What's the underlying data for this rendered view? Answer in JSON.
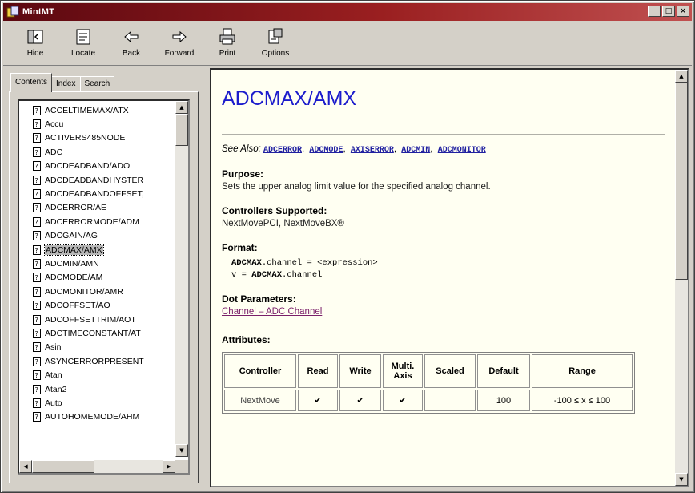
{
  "window": {
    "title": "MintMT"
  },
  "toolbar": {
    "buttons": [
      {
        "label": "Hide",
        "icon": "hide-icon"
      },
      {
        "label": "Locate",
        "icon": "locate-icon"
      },
      {
        "label": "Back",
        "icon": "back-arrow-icon"
      },
      {
        "label": "Forward",
        "icon": "forward-arrow-icon"
      },
      {
        "label": "Print",
        "icon": "print-icon"
      },
      {
        "label": "Options",
        "icon": "options-icon"
      }
    ]
  },
  "tabs": [
    {
      "label": "Contents",
      "active": true
    },
    {
      "label": "Index",
      "active": false
    },
    {
      "label": "Search",
      "active": false
    }
  ],
  "topic_list": {
    "selected": "ADCMAX/AMX",
    "items": [
      "ACCELTIMEMAX/ATX",
      "Accu",
      "ACTIVERS485NODE",
      "ADC",
      "ADCDEADBAND/ADO",
      "ADCDEADBANDHYSTER",
      "ADCDEADBANDOFFSET,",
      "ADCERROR/AE",
      "ADCERRORMODE/ADM",
      "ADCGAIN/AG",
      "ADCMAX/AMX",
      "ADCMIN/AMN",
      "ADCMODE/AM",
      "ADCMONITOR/AMR",
      "ADCOFFSET/AO",
      "ADCOFFSETTRIM/AOT",
      "ADCTIMECONSTANT/AT",
      "Asin",
      "ASYNCERRORPRESENT",
      "Atan",
      "Atan2",
      "Auto",
      "AUTOHOMEMODE/AHM"
    ]
  },
  "content": {
    "title": "ADCMAX/AMX",
    "see_also_label": "See Also:",
    "see_also": [
      "ADCERROR",
      "ADCMODE",
      "AXISERROR",
      "ADCMIN",
      "ADCMONITOR"
    ],
    "purpose_heading": "Purpose:",
    "purpose_text": "Sets the upper analog limit value for the specified analog channel.",
    "controllers_heading": "Controllers Supported:",
    "controllers_text": "NextMovePCI, NextMoveBX®",
    "format_heading": "Format:",
    "format_line1_cmd": "ADCMAX",
    "format_line1_rest": ".channel = <expression>",
    "format_line2_lead": "v = ",
    "format_line2_cmd": "ADCMAX",
    "format_line2_rest": ".channel",
    "dot_params_heading": "Dot Parameters:",
    "dot_params_link": "Channel – ADC Channel",
    "attributes_heading": "Attributes:",
    "attributes_table": {
      "headers": [
        "Controller",
        "Read",
        "Write",
        "Multi. Axis",
        "Scaled",
        "Default",
        "Range"
      ],
      "rows": [
        [
          "NextMove",
          "✔",
          "✔",
          "✔",
          "",
          "100",
          "-100 ≤ x ≤ 100"
        ]
      ]
    }
  }
}
